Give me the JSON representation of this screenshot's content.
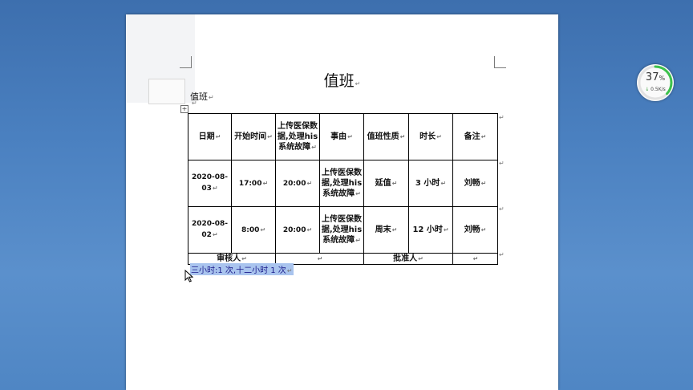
{
  "document": {
    "title": "值班",
    "subtitle": "值班",
    "pilcrow": "↵",
    "anchor_glyph": "+",
    "table": {
      "headers": [
        "日期",
        "开始时间",
        "上传医保数据,处理his 系统故障",
        "事由",
        "值班性质",
        "时长",
        "备注"
      ],
      "rows": [
        [
          "2020-08-03",
          "17:00",
          "20:00",
          "上传医保数据,处理his 系统故障",
          "延值",
          "3 小时",
          "刘畅"
        ],
        [
          "2020-08-02",
          "8:00",
          "20:00",
          "上传医保数据,处理his 系统故障",
          "周末",
          "12 小时",
          "刘畅"
        ]
      ],
      "signature": {
        "reviewer": "审核人",
        "approver": "批准人"
      }
    },
    "note": "三小时:1 次,十二小时 1 次"
  },
  "widget": {
    "percent": "37",
    "percent_sym": "%",
    "speed_arrow": "↓",
    "speed": "0.5K/s",
    "fill_fraction": 0.37,
    "ring_color": "#3cc24b"
  }
}
